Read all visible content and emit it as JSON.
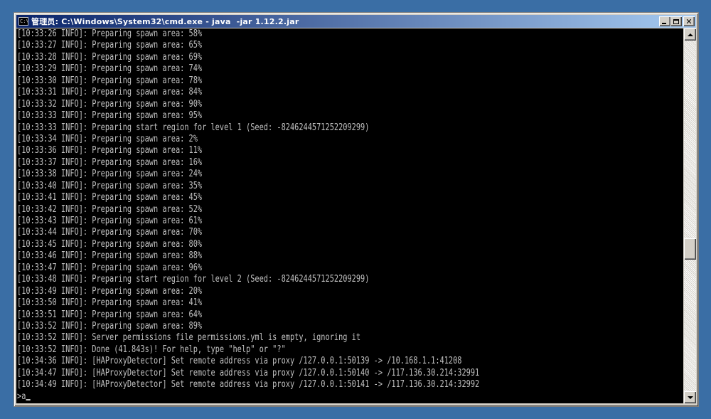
{
  "window": {
    "title": "管理员: C:\\Windows\\System32\\cmd.exe - java  -jar 1.12.2.jar",
    "icon_label": "C:\\",
    "icon": "cmd-console-icon"
  },
  "title_buttons": {
    "minimize": "minimize-icon",
    "maximize": "maximize-icon",
    "close_glyph": "✕"
  },
  "console": {
    "lines": [
      "[10:33:26 INFO]: Preparing spawn area: 58%",
      "[10:33:27 INFO]: Preparing spawn area: 65%",
      "[10:33:28 INFO]: Preparing spawn area: 69%",
      "[10:33:29 INFO]: Preparing spawn area: 74%",
      "[10:33:30 INFO]: Preparing spawn area: 78%",
      "[10:33:31 INFO]: Preparing spawn area: 84%",
      "[10:33:32 INFO]: Preparing spawn area: 90%",
      "[10:33:33 INFO]: Preparing spawn area: 95%",
      "[10:33:33 INFO]: Preparing start region for level 1 (Seed: -8246244571252209299)",
      "[10:33:34 INFO]: Preparing spawn area: 2%",
      "[10:33:36 INFO]: Preparing spawn area: 11%",
      "[10:33:37 INFO]: Preparing spawn area: 16%",
      "[10:33:38 INFO]: Preparing spawn area: 24%",
      "[10:33:40 INFO]: Preparing spawn area: 35%",
      "[10:33:41 INFO]: Preparing spawn area: 45%",
      "[10:33:42 INFO]: Preparing spawn area: 52%",
      "[10:33:43 INFO]: Preparing spawn area: 61%",
      "[10:33:44 INFO]: Preparing spawn area: 70%",
      "[10:33:45 INFO]: Preparing spawn area: 80%",
      "[10:33:46 INFO]: Preparing spawn area: 88%",
      "[10:33:47 INFO]: Preparing spawn area: 96%",
      "[10:33:48 INFO]: Preparing start region for level 2 (Seed: -8246244571252209299)",
      "[10:33:49 INFO]: Preparing spawn area: 20%",
      "[10:33:50 INFO]: Preparing spawn area: 41%",
      "[10:33:51 INFO]: Preparing spawn area: 64%",
      "[10:33:52 INFO]: Preparing spawn area: 89%",
      "[10:33:52 INFO]: Server permissions file permissions.yml is empty, ignoring it",
      "[10:33:52 INFO]: Done (41.843s)! For help, type \"help\" or \"?\"",
      "[10:34:36 INFO]: [HAProxyDetector] Set remote address via proxy /127.0.0.1:50139 -> /10.168.1.1:41208",
      "[10:34:47 INFO]: [HAProxyDetector] Set remote address via proxy /127.0.0.1:50140 -> /117.136.30.214:32991",
      "[10:34:49 INFO]: [HAProxyDetector] Set remote address via proxy /127.0.0.1:50141 -> /117.136.30.214:32992"
    ],
    "prompt": ">a",
    "text_color": "#c0c0c0",
    "background": "#000000"
  },
  "scrollbar": {
    "up_icon": "scroll-up-arrow-icon",
    "down_icon": "scroll-down-arrow-icon",
    "position_fraction": 0.6
  }
}
